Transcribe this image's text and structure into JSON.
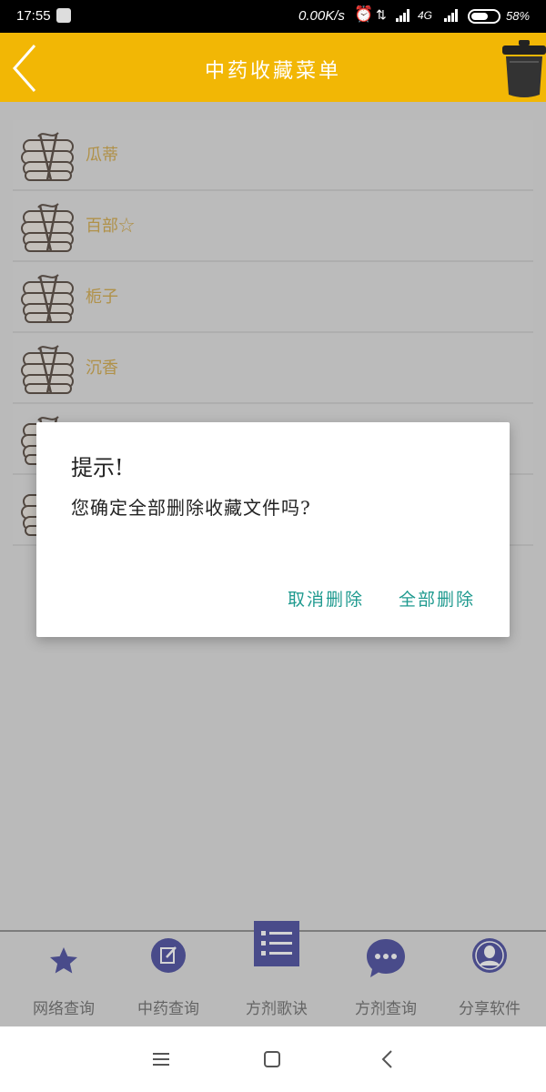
{
  "status_bar": {
    "time": "17:55",
    "net_speed": "0.00K/s",
    "network": "4G",
    "battery": "58%"
  },
  "header": {
    "title": "中药收藏菜单"
  },
  "favorites": [
    {
      "name": "瓜蒂"
    },
    {
      "name": "百部☆"
    },
    {
      "name": "栀子"
    },
    {
      "name": "沉香"
    },
    {
      "name": ""
    },
    {
      "name": ""
    }
  ],
  "bottom_nav": {
    "items": [
      {
        "label": "网络查询",
        "icon": "star-icon"
      },
      {
        "label": "中药查询",
        "icon": "edit-icon"
      },
      {
        "label": "方剂歌诀",
        "icon": "list-icon"
      },
      {
        "label": "方剂查询",
        "icon": "chat-icon"
      },
      {
        "label": "分享软件",
        "icon": "user-icon"
      }
    ]
  },
  "dialog": {
    "title": "提示!",
    "message": "您确定全部删除收藏文件吗?",
    "cancel_label": "取消删除",
    "confirm_label": "全部删除"
  },
  "colors": {
    "header_bg": "#f2b705",
    "nav_icon": "#2b2f8f",
    "dialog_button": "#1f9a8f",
    "item_text": "#c99a2c"
  }
}
